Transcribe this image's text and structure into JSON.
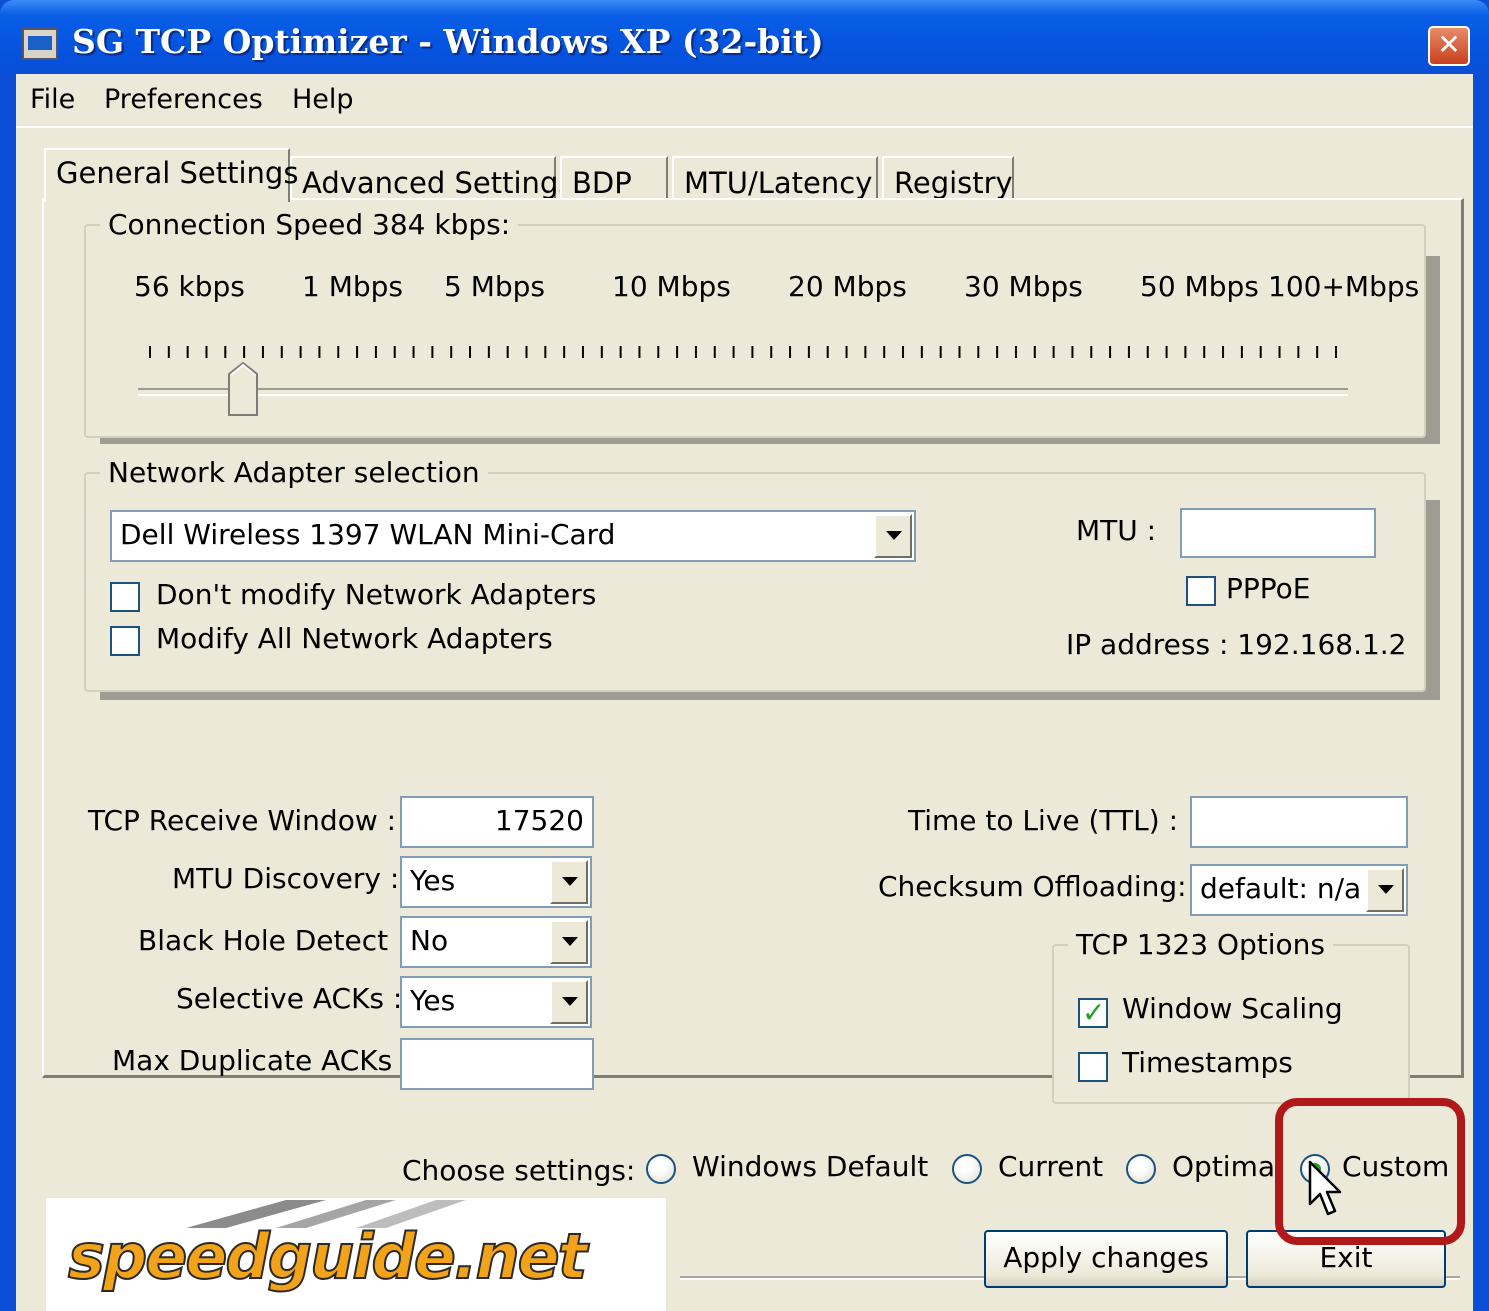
{
  "window": {
    "title": "SG TCP Optimizer - Windows XP (32-bit)",
    "close_glyph": "✕"
  },
  "menu": [
    "File",
    "Preferences",
    "Help"
  ],
  "tabs": [
    "General Settings",
    "Advanced Settings",
    "BDP",
    "MTU/Latency",
    "Registry"
  ],
  "connection_speed": {
    "label": "Connection Speed  384 kbps:",
    "scale": [
      "56 kbps",
      "1 Mbps",
      "5 Mbps",
      "10 Mbps",
      "20 Mbps",
      "30 Mbps",
      "50 Mbps",
      "100+Mbps"
    ],
    "level": 0.08
  },
  "adapter": {
    "label": "Network Adapter selection",
    "selected": "Dell Wireless 1397 WLAN Mini-Card",
    "dont_modify": "Don't modify Network Adapters",
    "modify_all": "Modify All Network Adapters",
    "mtu_label": "MTU :",
    "mtu_value": "",
    "pppoe": "PPPoE",
    "ip": "IP address : 192.168.1.2"
  },
  "settings": {
    "tcp_rwin_label": "TCP Receive Window :",
    "tcp_rwin": "17520",
    "mtu_disc_label": "MTU Discovery :",
    "mtu_disc": "Yes",
    "bhd_label": "Black Hole Detect :",
    "bhd": "No",
    "sack_label": "Selective ACKs :",
    "sack": "Yes",
    "maxdup_label": "Max Duplicate ACKs :",
    "maxdup": "",
    "ttl_label": "Time to Live (TTL) :",
    "ttl": "",
    "checksum_label": "Checksum Offloading:",
    "checksum": "default: n/a"
  },
  "tcp1323": {
    "label": "TCP 1323 Options",
    "window_scaling": "Window Scaling",
    "timestamps": "Timestamps"
  },
  "choose": {
    "label": "Choose settings:",
    "options": [
      "Windows Default",
      "Current",
      "Optimal",
      "Custom"
    ],
    "selected": "Custom"
  },
  "buttons": {
    "apply": "Apply changes",
    "exit": "Exit"
  },
  "logo": "speedguide.net",
  "colors": {
    "xp_blue": "#0a4fd6",
    "face": "#ece9d8",
    "highlight": "#b0181a",
    "logo_orange": "#f3a31a"
  }
}
